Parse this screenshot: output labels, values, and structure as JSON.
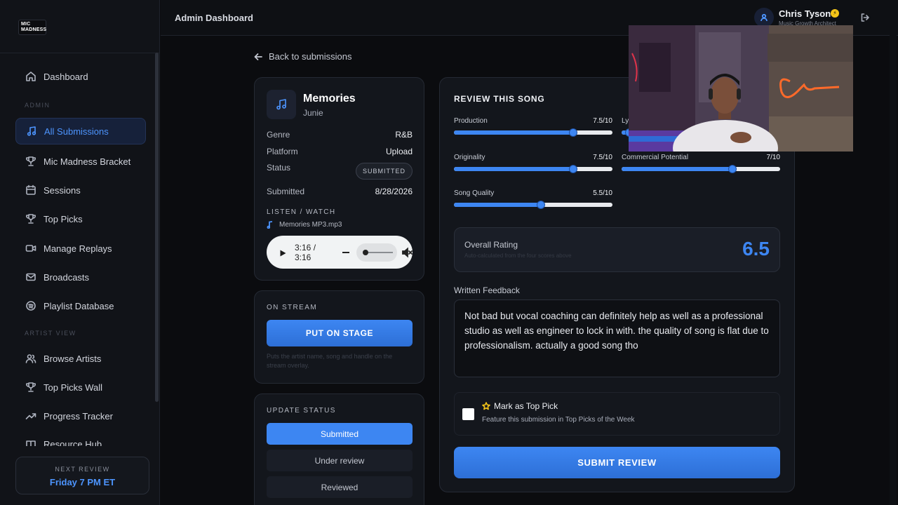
{
  "sidebar": {
    "logo_line1": "MIC",
    "logo_line2": "MADNESS",
    "items": [
      {
        "label": "Dashboard"
      },
      {
        "label": "All Submissions"
      },
      {
        "label": "Mic Madness Bracket"
      },
      {
        "label": "Sessions"
      },
      {
        "label": "Top Picks"
      },
      {
        "label": "Manage Replays"
      },
      {
        "label": "Broadcasts"
      },
      {
        "label": "Playlist Database"
      },
      {
        "label": "Browse Artists"
      },
      {
        "label": "Top Picks Wall"
      },
      {
        "label": "Progress Tracker"
      },
      {
        "label": "Resource Hub"
      }
    ],
    "section_admin": "ADMIN",
    "section_artist": "ARTIST VIEW",
    "next_review": {
      "label": "NEXT REVIEW",
      "value": "Friday 7 PM ET"
    }
  },
  "header": {
    "title": "Admin Dashboard",
    "user_name": "Chris Tyson",
    "user_role": "Music Growth Architect"
  },
  "back_label": "Back to submissions",
  "song": {
    "title": "Memories",
    "artist": "Junie",
    "genre_label": "Genre",
    "genre": "R&B",
    "platform_label": "Platform",
    "platform": "Upload",
    "status_label": "Status",
    "status": "SUBMITTED",
    "submitted_label": "Submitted",
    "submitted": "8/28/2026",
    "listen_label": "LISTEN / WATCH",
    "file_name": "Memories MP3.mp3",
    "time": "3:16 / 3:16"
  },
  "stream": {
    "label": "ON STREAM",
    "button": "PUT ON STAGE",
    "help": "Puts the artist name, song and handle on the stream overlay."
  },
  "update_status": {
    "label": "UPDATE STATUS",
    "options": [
      "Submitted",
      "Under review",
      "Reviewed"
    ],
    "selected": "Submitted"
  },
  "review": {
    "title": "REVIEW THIS SONG",
    "sliders": [
      {
        "name": "Production",
        "score": "7.5/10",
        "value": 7.5
      },
      {
        "name": "Lyrics",
        "score": "",
        "value": 0.5
      },
      {
        "name": "Originality",
        "score": "7.5/10",
        "value": 7.5
      },
      {
        "name": "Commercial Potential",
        "score": "7/10",
        "value": 7
      },
      {
        "name": "Song Quality",
        "score": "5.5/10",
        "value": 5.5
      }
    ],
    "overall_label": "Overall Rating",
    "overall_sub": "Auto-calculated from the four scores above",
    "overall_value": "6.5",
    "feedback_label": "Written Feedback",
    "feedback_text": "Not bad but vocal coaching can definitely help as well as a professional studio as well as engineer to lock in with. the quality of song is flat due to professionalism. actually a good song tho",
    "top_pick_label": "Mark as Top Pick",
    "top_pick_sub": "Feature this submission in Top Picks of the Week",
    "submit_label": "SUBMIT REVIEW"
  },
  "colors": {
    "accent": "#3d86f2",
    "badge": "#f5c518",
    "background": "#0b0c0f"
  }
}
